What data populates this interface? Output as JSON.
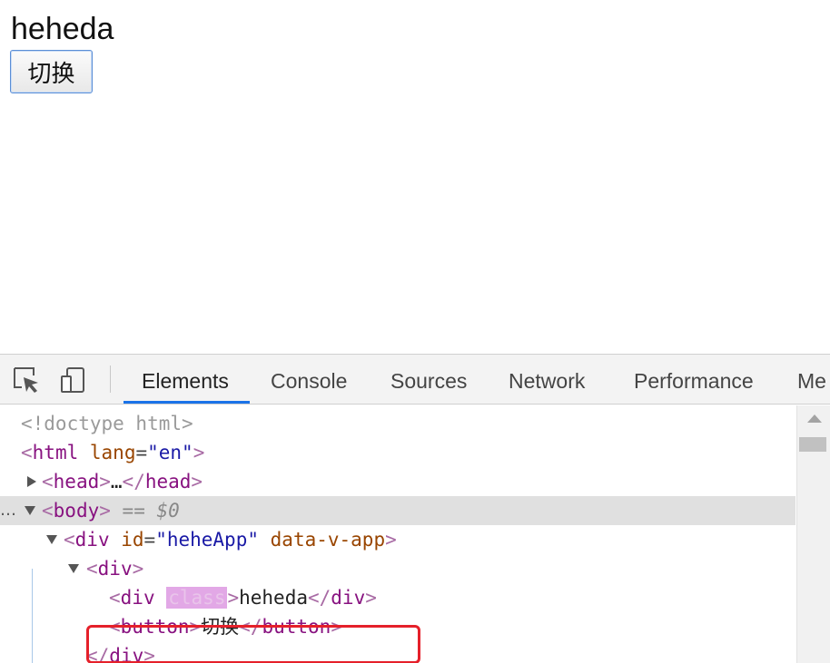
{
  "page": {
    "heading": "heheda",
    "button_label": "切换"
  },
  "devtools": {
    "tabs": [
      {
        "label": "Elements",
        "active": true
      },
      {
        "label": "Console"
      },
      {
        "label": "Sources"
      },
      {
        "label": "Network"
      },
      {
        "label": "Performance"
      },
      {
        "label": "Me"
      }
    ],
    "tree": {
      "doctype": "<!doctype html>",
      "html_tag": "html",
      "html_attr": "lang",
      "html_attr_val": "\"en\"",
      "head_tag": "head",
      "head_ellipsis": "…",
      "body_tag": "body",
      "body_marker": "== $0",
      "div1_tag": "div",
      "div1_attr1": "id",
      "div1_attr1_val": "\"heheApp\"",
      "div1_attr2": "data-v-app",
      "div2_tag": "div",
      "inner_div_tag": "div",
      "inner_div_attr": "class",
      "inner_div_text": "heheda",
      "button_tag": "button",
      "button_text": "切换",
      "closing_div": "div"
    },
    "row_dots": "…"
  },
  "colors": {
    "tab_underline": "#1a73e8",
    "highlight_box": "#e5202a",
    "tag": "#881280",
    "attr": "#994500",
    "value": "#1a1aa6"
  }
}
